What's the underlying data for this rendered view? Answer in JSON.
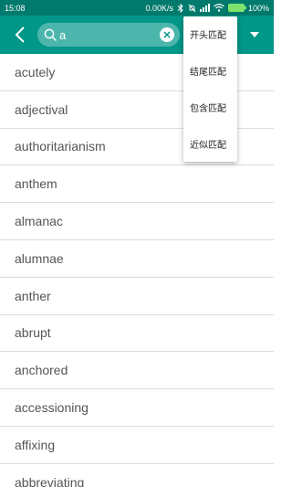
{
  "status_bar": {
    "time": "15:08",
    "network_speed": "0.00K/s",
    "battery": "100%"
  },
  "search": {
    "query": "a"
  },
  "match_menu": {
    "items": [
      "开头匹配",
      "结尾匹配",
      "包含匹配",
      "近似匹配"
    ]
  },
  "results": [
    "acutely",
    "adjectival",
    "authoritarianism",
    "anthem",
    "almanac",
    "alumnae",
    "anther",
    "abrupt",
    "anchored",
    "accessioning",
    "affixing",
    "abbreviating"
  ],
  "colors": {
    "status_bar": "#007a6c",
    "toolbar": "#009688",
    "search_box": "#4db6ac"
  },
  "icons": [
    "back-arrow",
    "search",
    "clear",
    "dropdown-arrow",
    "bluetooth",
    "bell-off",
    "signal",
    "wifi",
    "battery"
  ]
}
